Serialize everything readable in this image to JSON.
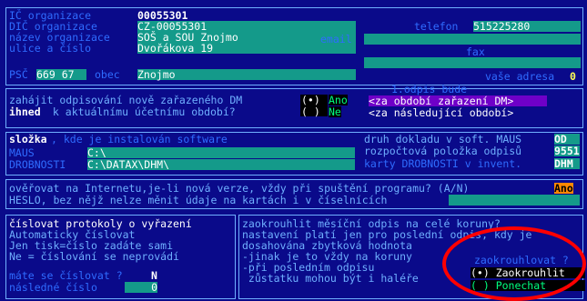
{
  "org": {
    "ico_label": "IČ organizace",
    "ico_value": "00055301",
    "dic_label": "DIČ organizace",
    "dic_value": "CZ-00055301",
    "nazev_label": "název organizace",
    "nazev_value": "SOŠ a SOU Znojmo",
    "ulice_label": "ulice a číslo",
    "ulice_value": "Dvořákova 19",
    "psc_label": "PSČ",
    "psc_value": "669 67",
    "obec_label": "obec",
    "obec_value": "Znojmo",
    "telefon_label": "telefon",
    "telefon_value": "515225280",
    "email_label": "email",
    "email_value": "",
    "fax_label": "fax",
    "fax_value": "",
    "vase_adresa_label": "vaše adresa",
    "vase_adresa_value": "0"
  },
  "odpis": {
    "question_line1": "zahájit odpisování nově zařazeného DM",
    "question_line2_a": "ihned",
    "question_line2_b": " k aktuálnímu účetnímu období?",
    "ano": "Ano",
    "ne": "Ne",
    "option_header": "1.odpis bude",
    "option1": "<za období zařazení DM>",
    "option2": "<za následující období>"
  },
  "slozka": {
    "label_a": "složka",
    "label_b": ", kde je instalován software",
    "maus_label": "MAUS",
    "maus_value": "C:\\",
    "drobnosti_label": "DROBNOSTI",
    "drobnosti_value": "C:\\DATAX\\DHM\\",
    "druh_line": "druh dokladu v soft. MAUS",
    "druh_value": "OD",
    "rozpoctova_line": "rozpočtová položka odpisů",
    "rozpoctova_value": "9551",
    "karty_line": "karty DROBNOSTI v invent.",
    "karty_value": "DHM"
  },
  "verze": {
    "line1": "ověřovat na Internetu,je-li nová verze, vždy při spuštění programu? (A/N)",
    "line1_value": "Ano",
    "line2": "HESLO, bez nějž nelze měnit údaje na kartách i v číselnících"
  },
  "protokoly": {
    "title": "číslovat protokoly o vyřazení",
    "line1": "Automaticky číslovat",
    "line2": "Jen tisk=číslo zadáte sami",
    "line3": "Ne = číslování se neprovádí",
    "mate_label": "máte se číslovat ?",
    "mate_value": "N",
    "nasledne_label": "následné číslo",
    "nasledne_value": "0"
  },
  "zaokrouhlit": {
    "title": "zaokrouhlit měsíční odpis na celé koruny?",
    "line1": "nastavení platí jen pro poslední odpis, kdy je",
    "line2": "dosahována zbytková hodnota",
    "line3": "-jinak je to vždy na koruny",
    "line4": "-při posledním odpisu",
    "line5": " zůstatku mohou být i haléře",
    "opt_header": "zaokrouhlovat ?",
    "opt1": "(•) Zaokrouhlit",
    "opt2": "( ) Ponechat"
  }
}
